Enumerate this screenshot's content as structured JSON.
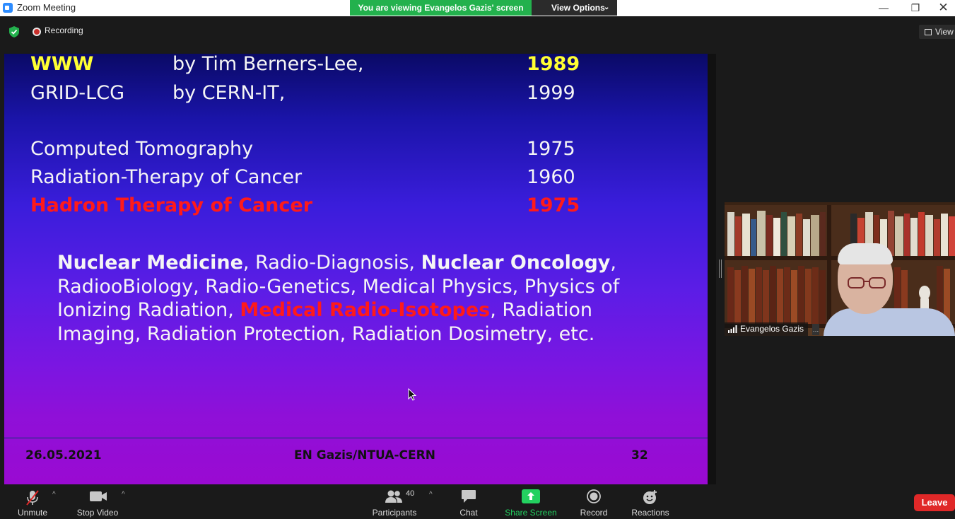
{
  "window": {
    "title": "Zoom Meeting",
    "share_banner": "You are viewing Evangelos Gazis' screen",
    "view_options": "View Options",
    "min": "—",
    "restore": "❐",
    "close": "✕"
  },
  "infobar": {
    "recording": "Recording",
    "view": "View"
  },
  "slide": {
    "rows": [
      {
        "name": "WWW",
        "by": "by Tim Berners-Lee,",
        "year": "1989"
      },
      {
        "name": "GRID-LCG",
        "by": "by CERN-IT,",
        "year": "1999"
      },
      {
        "name": "Computed Tomography",
        "year": "1975"
      },
      {
        "name": "Radiation-Therapy of Cancer",
        "year": "1960"
      },
      {
        "name": "Hadron Therapy of Cancer",
        "year": "1975"
      }
    ],
    "para": {
      "l1a": "Nuclear Medicine",
      "l1b": ", Radio-Diagnosis, ",
      "l1c": "Nuclear Oncology",
      "l1d": ",",
      "l2": "RadiooBiology, Radio-Genetics, Medical Physics, Physics of",
      "l3a": "Ionizing Radiation, ",
      "l3b": "Medical Radio-Isotopes",
      "l3c": ", Radiation",
      "l4": "Imaging, Radiation Protection, Radiation Dosimetry, etc."
    },
    "footer": {
      "date": "26.05.2021",
      "author": "EN Gazis/NTUA-CERN",
      "page": "32"
    }
  },
  "video": {
    "participant_name": "Evangelos Gazis",
    "menu": "…"
  },
  "toolbar": {
    "unmute": "Unmute",
    "stop_video": "Stop Video",
    "participants": "Participants",
    "participant_count": "40",
    "chat": "Chat",
    "share_screen": "Share Screen",
    "record": "Record",
    "reactions": "Reactions",
    "leave": "Leave",
    "caret": "^"
  },
  "colors": {
    "share_green": "#23b14d",
    "leave_red": "#e02828",
    "slide_yellow": "#ffff33",
    "slide_red": "#ff1a1a"
  }
}
